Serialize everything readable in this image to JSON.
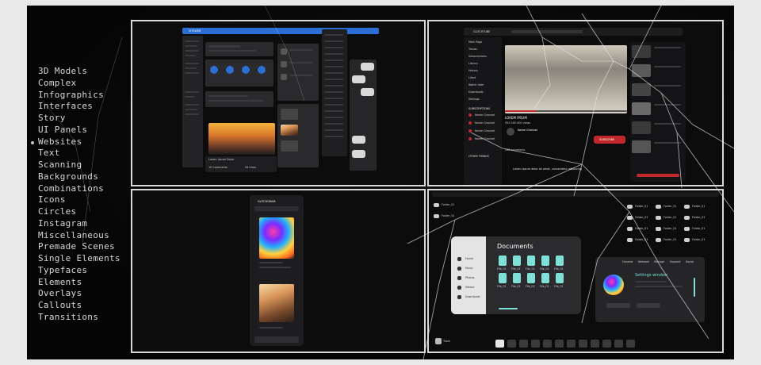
{
  "categories": {
    "items": [
      "3D Models",
      "Complex",
      "Infographics",
      "Interfaces",
      "Story",
      "UI Panels",
      "Websites",
      "Text",
      "Scanning",
      "Backgrounds",
      "Combinations",
      "Icons",
      "Circles",
      "Instagram",
      "Miscellaneous",
      "Premade Scenes",
      "Single Elements",
      "Typefaces",
      "Elements",
      "Overlays",
      "Callouts",
      "Transitions"
    ],
    "active": "Websites"
  },
  "panel_blog": {
    "app_label": "SITEWEB",
    "post_title": "Lorem Ipsum Dolor",
    "comments_label": "10 Comments",
    "likes_label": "54 Likes"
  },
  "panel_video": {
    "brand": "GLITCHTUBE",
    "menu": [
      "Main Page",
      "Trends",
      "Subscriptions",
      "Library",
      "History",
      "Liked",
      "Watch later",
      "Downloads",
      "Settings"
    ],
    "subscriptions_heading": "SUBSCRIPTIONS",
    "channels": [
      "Name Channel",
      "Name Channel",
      "Name Channel",
      "Name Channel"
    ],
    "video_title": "LOREM IPSUM",
    "views": "352 000 000 views",
    "channel_name": "Name Channel",
    "subscribe_label": "SUBSCRIBE",
    "other_things_heading": "OTHER THINGS",
    "comments_label": "245 comments",
    "comment_text": "Lorem ipsum dolor sit amet, consectetur adipiscing",
    "accent_color": "#c2282b"
  },
  "panel_phone": {
    "app_label": "GLITCHGRAM"
  },
  "panel_desktop": {
    "folder_label": "Folder_01",
    "trash_label": "Trash",
    "documents_title": "Documents",
    "sidebar_items": [
      "Home",
      "Music",
      "Photos",
      "Videos",
      "Downloads"
    ],
    "file_label": "File_01",
    "settings_title": "Settings window",
    "settings_tabs": [
      "General",
      "Network",
      "Storage",
      "Support",
      "Social"
    ],
    "accent_color": "#7fe0d8"
  }
}
